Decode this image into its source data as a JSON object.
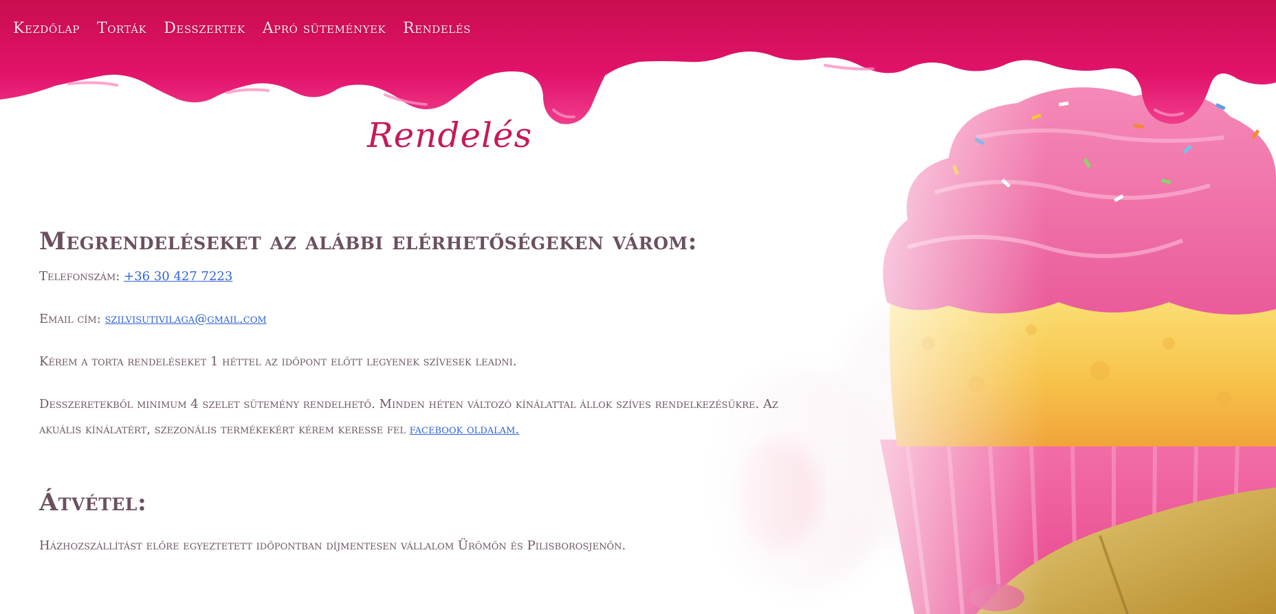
{
  "nav": {
    "items": [
      {
        "label": "Kezdőlap"
      },
      {
        "label": "Torták"
      },
      {
        "label": "Desszertek"
      },
      {
        "label": "Apró sütemények"
      },
      {
        "label": "Rendelés"
      }
    ]
  },
  "page": {
    "title": "Rendelés"
  },
  "order": {
    "heading": "Megrendeléseket az alábbi elérhetőségeken várom:",
    "phone_label": "Telefonszám: ",
    "phone_value": "+36 30 427 7223",
    "email_label": "Email cím: ",
    "email_value": "szilvisutivilaga@gmail.com",
    "cake_note": "Kérem a torta rendeléseket 1 héttel az időpont előtt legyenek szívesek leadni.",
    "dessert_note_1": "Desszeretekből minimum 4 szelet sütemény rendelhető. Minden héten változó kínálattal állok szíves rendelkezésükre. Az akuális kínálatért, szezonális termékekért kérem keresse fel ",
    "facebook_link": "facebook oldalam."
  },
  "pickup": {
    "heading": "Átvétel:",
    "delivery_note": "Házhozszállítást előre egyeztetett időpontban díjmentesen vállalom Ürömön és Pilisborosjenőn."
  },
  "colors": {
    "drip": "#e0115f",
    "title": "#c41a5a",
    "link": "#2f62d8",
    "text": "#6e5866"
  }
}
